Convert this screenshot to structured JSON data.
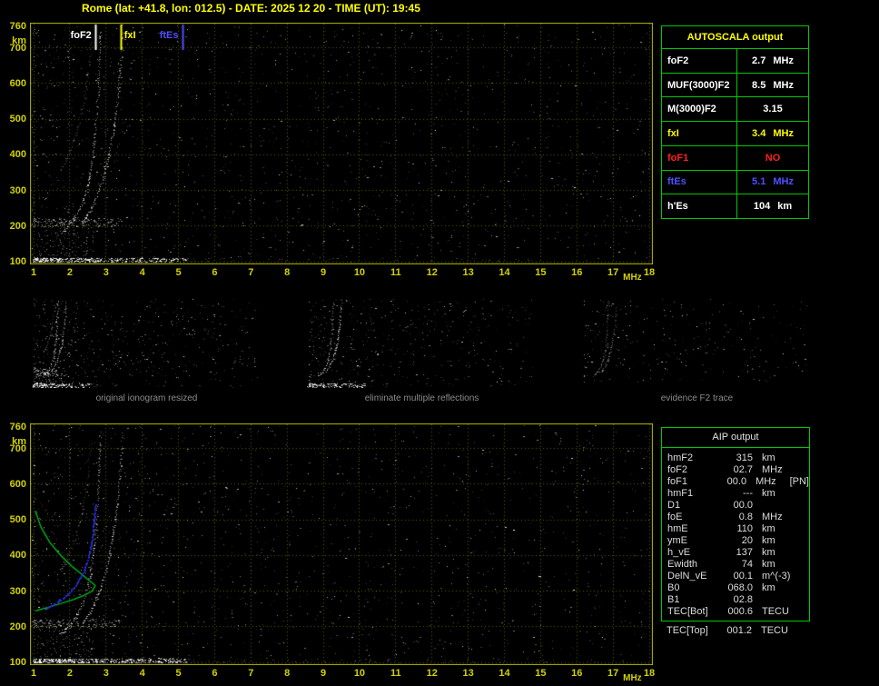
{
  "title": "Rome (lat: +41.8, lon: 012.5) - DATE: 2025 12 20 - TIME (UT): 19:45",
  "colors": {
    "background": "#000000",
    "title_yellow": "#ffff00",
    "axis_ticks": "#d2d200",
    "plot_border": "#b8b800",
    "grid": "#5e5e00",
    "table_border": "#00c800",
    "white": "#ffffff",
    "yellow": "#ffff00",
    "red": "#ff2020",
    "blue": "#5050ff",
    "profile_green": "#00c020",
    "restored_blue": "#2830dc",
    "caption_gray": "#8c8c8c",
    "aip_text": "#dcdcdc"
  },
  "autoscala": {
    "title": "AUTOSCALA output",
    "rows": [
      {
        "label": "foF2",
        "value": "2.7",
        "unit": "MHz",
        "color": "#ffffff"
      },
      {
        "label": "MUF(3000)F2",
        "value": "8.5",
        "unit": "MHz",
        "color": "#ffffff"
      },
      {
        "label": "M(3000)F2",
        "value": "3.15",
        "unit": "",
        "color": "#ffffff"
      },
      {
        "label": "fxI",
        "value": "3.4",
        "unit": "MHz",
        "color": "#ffff00"
      },
      {
        "label": "foF1",
        "value": "NO",
        "unit": "",
        "color": "#ff2020"
      },
      {
        "label": "ftEs",
        "value": "5.1",
        "unit": "MHz",
        "color": "#5050ff"
      },
      {
        "label": "h'Es",
        "value": "104",
        "unit": "km",
        "color": "#ffffff"
      }
    ]
  },
  "aip": {
    "title": "AIP output",
    "rows": [
      {
        "name": "hmF2",
        "value": "315",
        "unit": "km",
        "extra": ""
      },
      {
        "name": "foF2",
        "value": "02.7",
        "unit": "MHz",
        "extra": ""
      },
      {
        "name": "foF1",
        "value": "00.0",
        "unit": "MHz",
        "extra": "[PN]"
      },
      {
        "name": "hmF1",
        "value": "---",
        "unit": "km",
        "extra": ""
      },
      {
        "name": "D1",
        "value": "00.0",
        "unit": "",
        "extra": ""
      },
      {
        "name": "foE",
        "value": "0.8",
        "unit": "MHz",
        "extra": ""
      },
      {
        "name": "hmE",
        "value": "110",
        "unit": "km",
        "extra": ""
      },
      {
        "name": "ymE",
        "value": "20",
        "unit": "km",
        "extra": ""
      },
      {
        "name": "h_vE",
        "value": "137",
        "unit": "km",
        "extra": ""
      },
      {
        "name": "Ewidth",
        "value": "74",
        "unit": "km",
        "extra": ""
      },
      {
        "name": "DelN_vE",
        "value": "00.1",
        "unit": "m^(-3)",
        "extra": ""
      },
      {
        "name": "B0",
        "value": "068.0",
        "unit": "km",
        "extra": ""
      },
      {
        "name": "B1",
        "value": "02.8",
        "unit": "",
        "extra": ""
      },
      {
        "name": "TEC[Bot]",
        "value": "000.6",
        "unit": "TECU",
        "extra": ""
      },
      {
        "name": "TEC[Top]",
        "value": "001.2",
        "unit": "TECU",
        "extra": ""
      }
    ]
  },
  "chart_data": [
    {
      "id": "main-ionogram",
      "type": "scatter",
      "title": "ionogram echoes",
      "xlabel": "MHz",
      "ylabel": "km",
      "xlim": [
        1,
        18
      ],
      "ylim": [
        100,
        760
      ],
      "grid": true,
      "x_ticks": [
        1,
        2,
        3,
        4,
        5,
        6,
        7,
        8,
        9,
        10,
        11,
        12,
        13,
        14,
        15,
        16,
        17,
        18
      ],
      "y_ticks": [
        760,
        700,
        600,
        500,
        400,
        300,
        200,
        100
      ],
      "annotations": [
        {
          "label": "foF2",
          "freq_mhz": 2.7,
          "color": "#ffffff",
          "side": "left"
        },
        {
          "label": "fxI",
          "freq_mhz": 3.4,
          "color": "#ffff00",
          "side": "right"
        },
        {
          "label": "ftEs",
          "freq_mhz": 5.1,
          "color": "#5050ff",
          "side": "left"
        }
      ],
      "traces": {
        "es_layer": {
          "height_km": 104,
          "f_start": 1.0,
          "f_end": 5.2
        },
        "es_second_hop": {
          "height_km": 209,
          "f_start": 1.0,
          "f_end": 3.4
        },
        "f2_ordinary": [
          [
            1.75,
            178
          ],
          [
            1.9,
            192
          ],
          [
            2.05,
            210
          ],
          [
            2.2,
            232
          ],
          [
            2.33,
            258
          ],
          [
            2.45,
            292
          ],
          [
            2.55,
            335
          ],
          [
            2.63,
            390
          ],
          [
            2.7,
            455
          ],
          [
            2.76,
            530
          ],
          [
            2.8,
            610
          ],
          [
            2.83,
            690
          ],
          [
            2.85,
            748
          ]
        ],
        "f2_extraordinary": [
          [
            2.35,
            210
          ],
          [
            2.5,
            232
          ],
          [
            2.65,
            260
          ],
          [
            2.8,
            295
          ],
          [
            2.95,
            340
          ],
          [
            3.08,
            395
          ],
          [
            3.2,
            460
          ],
          [
            3.3,
            535
          ],
          [
            3.38,
            615
          ],
          [
            3.44,
            700
          ],
          [
            3.47,
            748
          ]
        ],
        "f2_second_hop": [
          [
            1.75,
            356
          ],
          [
            1.9,
            384
          ],
          [
            2.05,
            420
          ],
          [
            2.2,
            464
          ],
          [
            2.33,
            516
          ],
          [
            2.45,
            584
          ],
          [
            2.55,
            670
          ],
          [
            2.6,
            730
          ]
        ]
      }
    },
    {
      "id": "thumb-original",
      "type": "scatter",
      "caption": "original ionogram resized"
    },
    {
      "id": "thumb-cleaned",
      "type": "scatter",
      "caption": "eliminate multiple reflections"
    },
    {
      "id": "thumb-f2",
      "type": "scatter",
      "caption": "evidence F2 trace"
    },
    {
      "id": "profile-ionogram",
      "type": "scatter",
      "title": "restored trace and electron density profile",
      "xlabel": "MHz",
      "ylabel": "km",
      "xlim": [
        1,
        18
      ],
      "ylim": [
        100,
        760
      ],
      "grid": true,
      "x_ticks": [
        1,
        2,
        3,
        4,
        5,
        6,
        7,
        8,
        9,
        10,
        11,
        12,
        13,
        14,
        15,
        16,
        17,
        18
      ],
      "y_ticks": [
        760,
        700,
        600,
        500,
        400,
        300,
        200,
        100
      ],
      "profile_color": "#00c020",
      "trace_color": "#2830dc",
      "profile_curve": [
        [
          1.05,
          525
        ],
        [
          1.2,
          480
        ],
        [
          1.45,
          436
        ],
        [
          1.75,
          400
        ],
        [
          2.05,
          370
        ],
        [
          2.35,
          345
        ],
        [
          2.55,
          328
        ],
        [
          2.68,
          318
        ],
        [
          2.7,
          315
        ],
        [
          2.62,
          300
        ],
        [
          2.4,
          288
        ],
        [
          2.1,
          276
        ],
        [
          1.75,
          265
        ],
        [
          1.45,
          256
        ],
        [
          1.2,
          249
        ],
        [
          1.05,
          244
        ]
      ],
      "restored_trace": [
        [
          1.35,
          252
        ],
        [
          1.55,
          263
        ],
        [
          1.75,
          276
        ],
        [
          1.95,
          292
        ],
        [
          2.12,
          312
        ],
        [
          2.27,
          334
        ],
        [
          2.4,
          360
        ],
        [
          2.5,
          392
        ],
        [
          2.58,
          428
        ],
        [
          2.64,
          468
        ],
        [
          2.68,
          510
        ],
        [
          2.7,
          545
        ]
      ]
    }
  ]
}
